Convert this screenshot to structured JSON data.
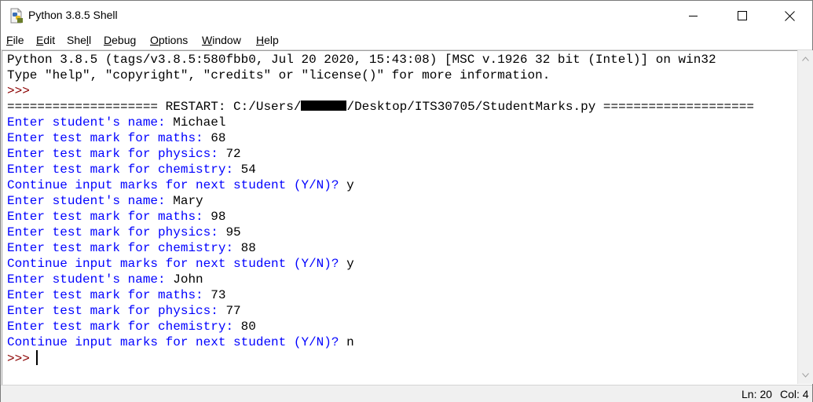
{
  "window": {
    "title": "Python 3.8.5 Shell",
    "app_icon": "python-idle-icon",
    "controls": [
      "minimize-icon",
      "maximize-icon",
      "close-icon"
    ]
  },
  "menubar": {
    "items": [
      {
        "label": "File",
        "mnemonic": "F"
      },
      {
        "label": "Edit",
        "mnemonic": "E"
      },
      {
        "label": "Shell",
        "mnemonic": "l"
      },
      {
        "label": "Debug",
        "mnemonic": "D"
      },
      {
        "label": "Options",
        "mnemonic": "O"
      },
      {
        "label": "Window",
        "mnemonic": "W"
      },
      {
        "label": "Help",
        "mnemonic": "H"
      }
    ]
  },
  "shell": {
    "banner_line1": "Python 3.8.5 (tags/v3.8.5:580fbb0, Jul 20 2020, 15:43:08) [MSC v.1926 32 bit (Intel)] on win32",
    "banner_line2": "Type \"help\", \"copyright\", \"credits\" or \"license()\" for more information.",
    "prompt": ">>>",
    "restart_prefix": "==================== RESTART: C:/Users/",
    "restart_suffix": "/Desktop/ITS30705/StudentMarks.py ====================",
    "io_lines": [
      {
        "prompt": "Enter student's name: ",
        "input": "Michael"
      },
      {
        "prompt": "Enter test mark for maths: ",
        "input": "68"
      },
      {
        "prompt": "Enter test mark for physics: ",
        "input": "72"
      },
      {
        "prompt": "Enter test mark for chemistry: ",
        "input": "54"
      },
      {
        "prompt": "Continue input marks for next student (Y/N)? ",
        "input": "y"
      },
      {
        "prompt": "Enter student's name: ",
        "input": "Mary"
      },
      {
        "prompt": "Enter test mark for maths: ",
        "input": "98"
      },
      {
        "prompt": "Enter test mark for physics: ",
        "input": "95"
      },
      {
        "prompt": "Enter test mark for chemistry: ",
        "input": "88"
      },
      {
        "prompt": "Continue input marks for next student (Y/N)? ",
        "input": "y"
      },
      {
        "prompt": "Enter student's name: ",
        "input": "John"
      },
      {
        "prompt": "Enter test mark for maths: ",
        "input": "73"
      },
      {
        "prompt": "Enter test mark for physics: ",
        "input": "77"
      },
      {
        "prompt": "Enter test mark for chemistry: ",
        "input": "80"
      },
      {
        "prompt": "Continue input marks for next student (Y/N)? ",
        "input": "n"
      }
    ],
    "final_prompt": ">>>"
  },
  "statusbar": {
    "line": "Ln: 20",
    "col": "Col: 4"
  },
  "colors": {
    "output_blue": "#0000ff",
    "prompt_red": "#8b0000",
    "input_black": "#000000"
  }
}
